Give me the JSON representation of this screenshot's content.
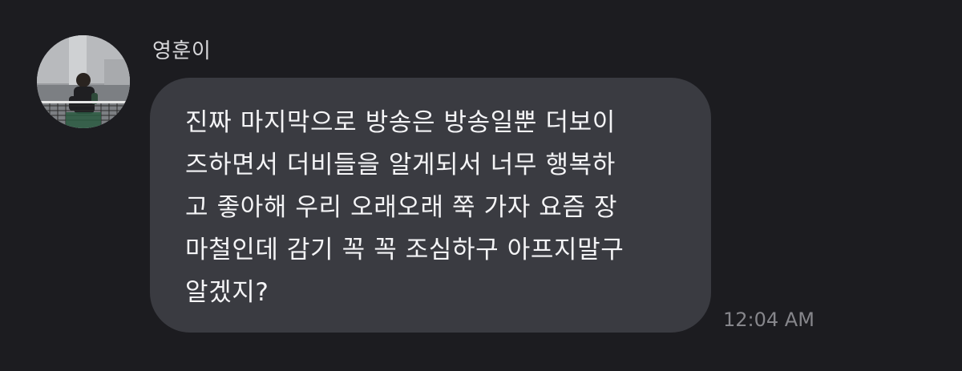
{
  "conversation": {
    "sender_name": "영훈이",
    "avatar_icon": "profile-photo",
    "message_text": "진짜 마지막으로 방송은 방송일뿐  더보이\n즈하면서 더비들을 알게되서 너무 행복하\n고 좋아해 우리 오래오래 쭉 가자 요즘 장\n마철인데 감기 꼭 꼭 조심하구 아프지말구\n알겠지?",
    "timestamp": "12:04 AM"
  },
  "colors": {
    "background": "#1c1c20",
    "bubble": "#3a3b41",
    "message_text": "#f4f4f6",
    "sender_text": "#d7d7da",
    "timestamp_text": "#86868b"
  }
}
